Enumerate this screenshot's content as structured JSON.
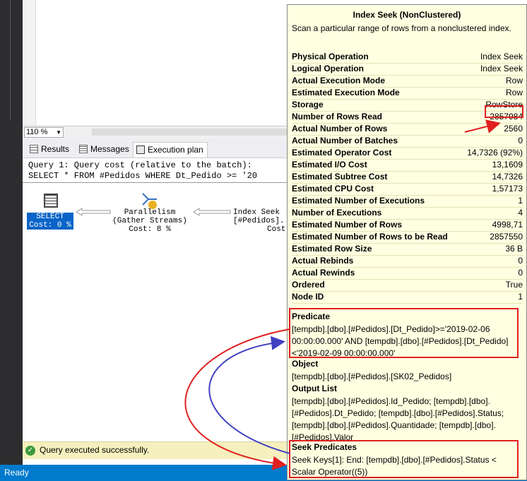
{
  "editor": {
    "zoom": "110 %"
  },
  "tabs": [
    {
      "label": "Results",
      "icon": "grid-icon"
    },
    {
      "label": "Messages",
      "icon": "messages-icon"
    },
    {
      "label": "Execution plan",
      "icon": "execution-plan-icon"
    }
  ],
  "plan": {
    "query_header": "Query 1: Query cost (relative to the batch):",
    "query_text": "SELECT * FROM #Pedidos WHERE Dt_Pedido >= '20",
    "nodes": {
      "select": {
        "name": "SELECT",
        "cost": "Cost: 0 %"
      },
      "parallelism": {
        "name": "Parallelism",
        "sub": "(Gather Streams)",
        "cost": "Cost: 8 %"
      },
      "index_seek": {
        "name": "Index Seek",
        "sub": "[#Pedidos].",
        "cost": "Cost"
      }
    }
  },
  "status": {
    "message": "Query executed successfully.",
    "ready": "Ready"
  },
  "tooltip": {
    "title": "Index Seek (NonClustered)",
    "description": "Scan a particular range of rows from a nonclustered index.",
    "properties": [
      {
        "key": "Physical Operation",
        "value": "Index Seek"
      },
      {
        "key": "Logical Operation",
        "value": "Index Seek"
      },
      {
        "key": "Actual Execution Mode",
        "value": "Row"
      },
      {
        "key": "Estimated Execution Mode",
        "value": "Row"
      },
      {
        "key": "Storage",
        "value": "RowStore"
      },
      {
        "key": "Number of Rows Read",
        "value": "2857984"
      },
      {
        "key": "Actual Number of Rows",
        "value": "2560"
      },
      {
        "key": "Actual Number of Batches",
        "value": "0"
      },
      {
        "key": "Estimated Operator Cost",
        "value": "14,7326 (92%)"
      },
      {
        "key": "Estimated I/O Cost",
        "value": "13,1609"
      },
      {
        "key": "Estimated Subtree Cost",
        "value": "14,7326"
      },
      {
        "key": "Estimated CPU Cost",
        "value": "1,57173"
      },
      {
        "key": "Estimated Number of Executions",
        "value": "1"
      },
      {
        "key": "Number of Executions",
        "value": "4"
      },
      {
        "key": "Estimated Number of Rows",
        "value": "4998,71"
      },
      {
        "key": "Estimated Number of Rows to be Read",
        "value": "2857550"
      },
      {
        "key": "Estimated Row Size",
        "value": "36 B"
      },
      {
        "key": "Actual Rebinds",
        "value": "0"
      },
      {
        "key": "Actual Rewinds",
        "value": "0"
      },
      {
        "key": "Ordered",
        "value": "True"
      },
      {
        "key": "Node ID",
        "value": "1"
      }
    ],
    "predicate": {
      "heading": "Predicate",
      "lines": [
        "[tempdb].[dbo].[#Pedidos].[Dt_Pedido]>='2019-02-06",
        "00:00:00.000' AND [tempdb].[dbo].[#Pedidos].[Dt_Pedido]",
        "<'2019-02-09 00:00:00.000'"
      ]
    },
    "object": {
      "heading": "Object",
      "lines": [
        "[tempdb].[dbo].[#Pedidos].[SK02_Pedidos]"
      ]
    },
    "output_list": {
      "heading": "Output List",
      "lines": [
        "[tempdb].[dbo].[#Pedidos].Id_Pedido; [tempdb].[dbo].",
        "[#Pedidos].Dt_Pedido; [tempdb].[dbo].[#Pedidos].Status;",
        "[tempdb].[dbo].[#Pedidos].Quantidade; [tempdb].[dbo].",
        "[#Pedidos].Valor"
      ]
    },
    "seek_predicates": {
      "heading": "Seek Predicates",
      "lines": [
        "Seek Keys[1]: End: [tempdb].[dbo].[#Pedidos].Status <",
        "Scalar Operator((5))"
      ]
    }
  },
  "colors": {
    "accent": "#007acc",
    "highlight": "#e02020",
    "blue_arrow": "#4040c0",
    "tooltip_bg": "#ffffe1"
  }
}
